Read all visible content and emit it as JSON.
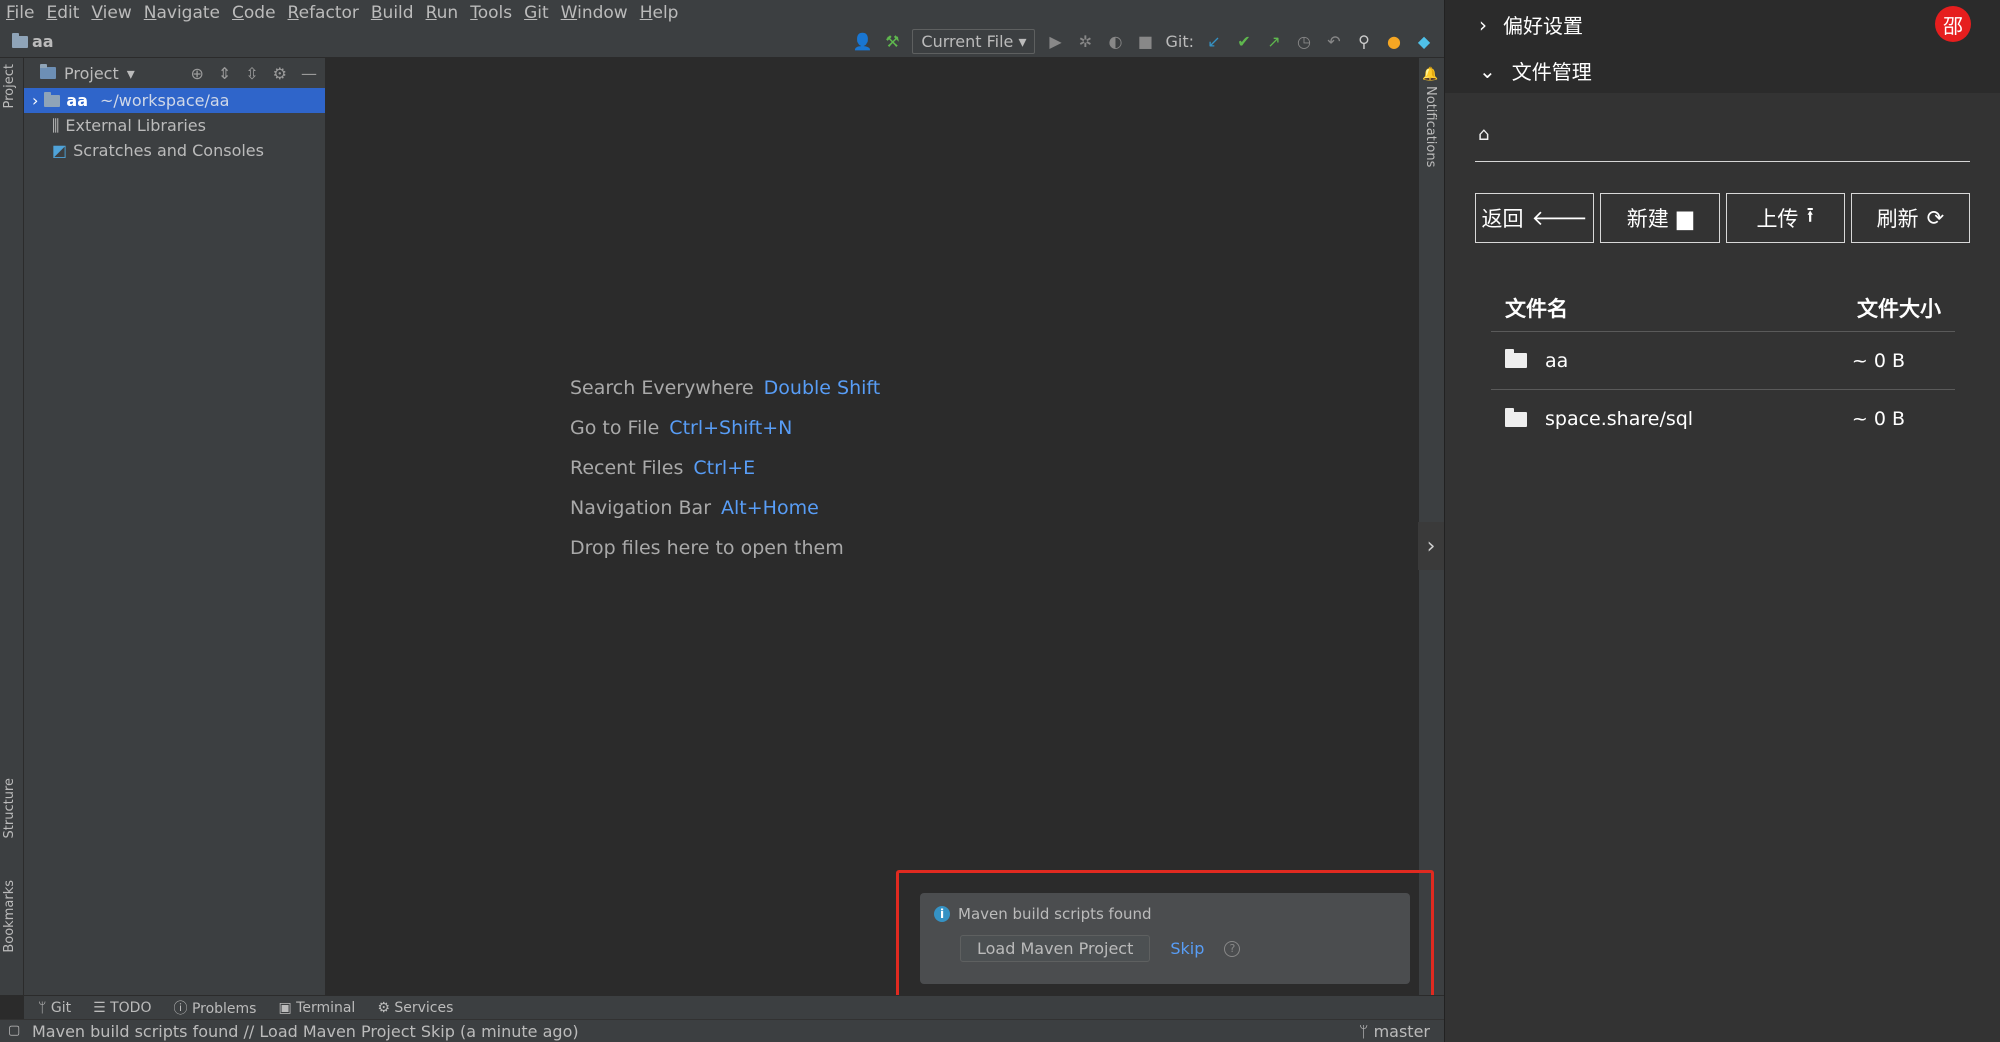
{
  "menu": [
    "File",
    "Edit",
    "View",
    "Navigate",
    "Code",
    "Refactor",
    "Build",
    "Run",
    "Tools",
    "Git",
    "Window",
    "Help"
  ],
  "toolbar": {
    "project_name": "aa",
    "run_config": "Current File",
    "git_label": "Git:"
  },
  "left_strip": {
    "project_tab": "Project",
    "structure_tab": "Structure",
    "bookmarks_tab": "Bookmarks"
  },
  "project_panel": {
    "title": "Project",
    "tree": [
      {
        "label": "aa",
        "path": "~/workspace/aa",
        "selected": true
      },
      {
        "label": "External Libraries"
      },
      {
        "label": "Scratches and Consoles"
      }
    ]
  },
  "editor": {
    "hints": [
      {
        "text": "Search Everywhere",
        "key": "Double Shift"
      },
      {
        "text": "Go to File",
        "key": "Ctrl+Shift+N"
      },
      {
        "text": "Recent Files",
        "key": "Ctrl+E"
      },
      {
        "text": "Navigation Bar",
        "key": "Alt+Home"
      },
      {
        "text": "Drop files here to open them",
        "key": ""
      }
    ]
  },
  "right_strip": {
    "notifications_tab": "Notifications"
  },
  "notification": {
    "title": "Maven build scripts found",
    "load_button": "Load Maven Project",
    "skip_link": "Skip",
    "highlight_color": "#e02a20"
  },
  "bottom_tabs": [
    "Git",
    "TODO",
    "Problems",
    "Terminal",
    "Services"
  ],
  "status": {
    "message": "Maven build scripts found // Load Maven Project   Skip (a minute ago)",
    "branch": "master"
  },
  "file_manager": {
    "sections": [
      {
        "label": "偏好设置",
        "expanded": false
      },
      {
        "label": "文件管理",
        "expanded": true
      }
    ],
    "avatar_text": "邵",
    "avatar_color": "#e61e1e",
    "buttons": [
      {
        "label": "返回",
        "icon": "arrow-left-icon",
        "glyph": "🡐"
      },
      {
        "label": "新建",
        "icon": "folder-icon",
        "glyph": "▆"
      },
      {
        "label": "上传",
        "icon": "upload-icon",
        "glyph": "⭱"
      },
      {
        "label": "刷新",
        "icon": "refresh-icon",
        "glyph": "⟳"
      }
    ],
    "table": {
      "headers": [
        "文件名",
        "文件大小"
      ],
      "rows": [
        {
          "name": "aa",
          "size": "~ 0 B"
        },
        {
          "name": "space.share/sql",
          "size": "~ 0 B"
        }
      ]
    }
  }
}
